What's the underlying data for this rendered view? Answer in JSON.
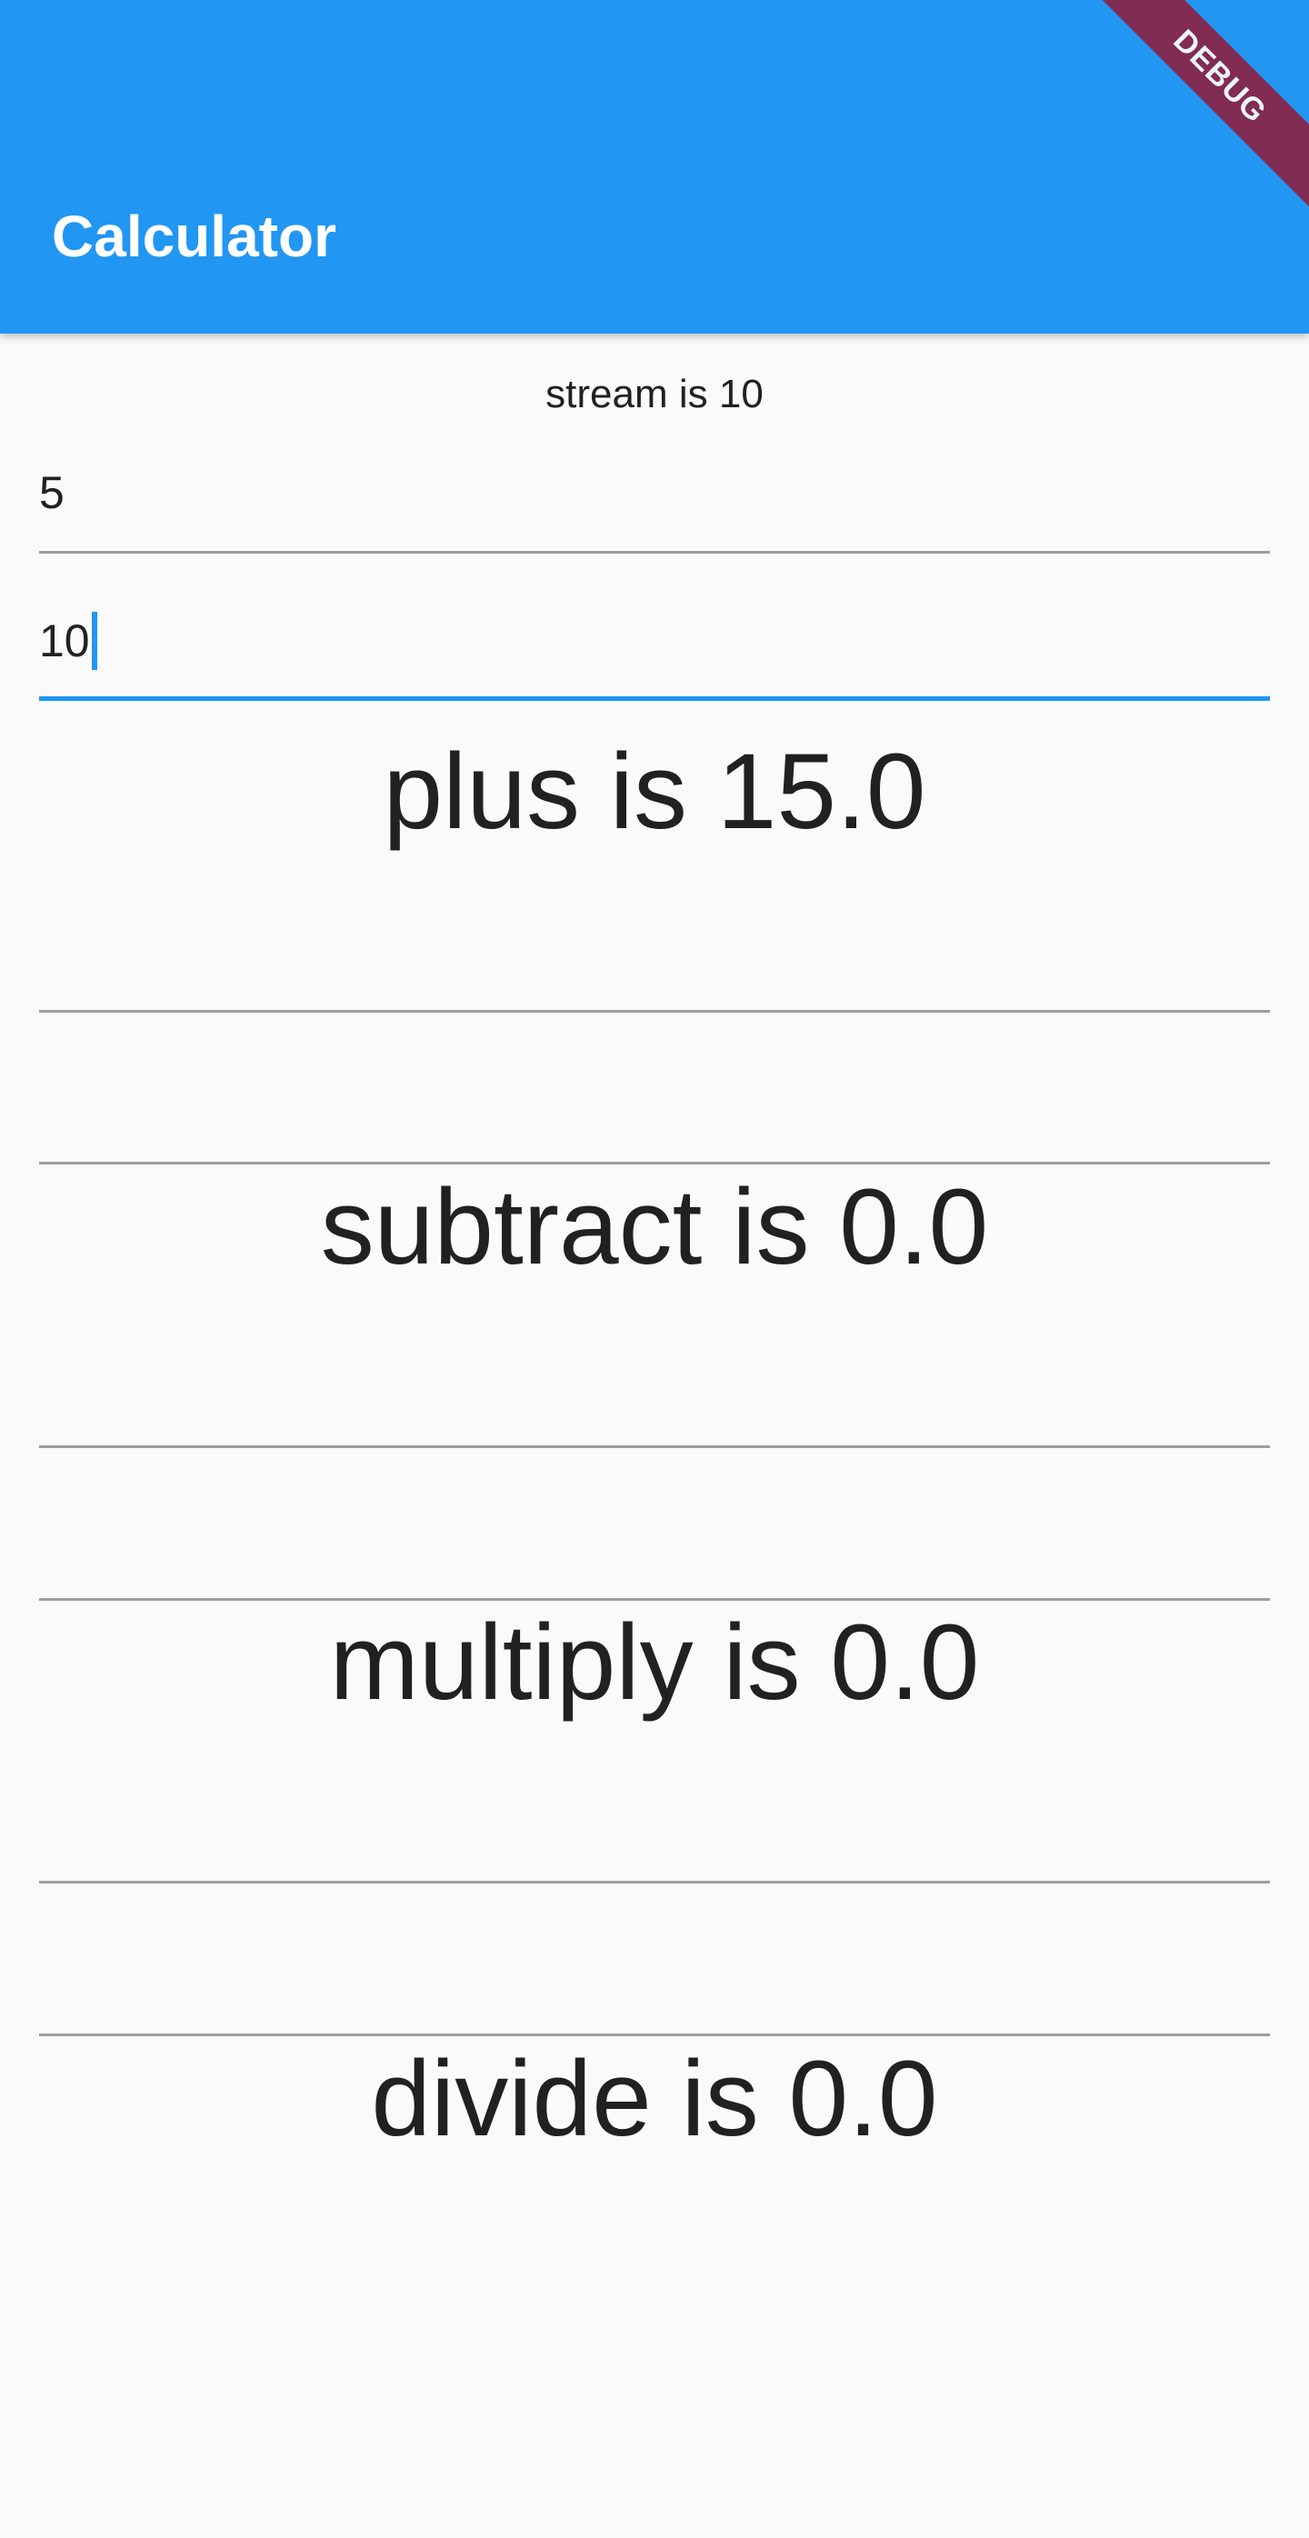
{
  "app_bar": {
    "title": "Calculator",
    "color": "#2196f3"
  },
  "debug_banner": {
    "label": "DEBUG"
  },
  "stream": {
    "text": "stream is 10"
  },
  "inputs": {
    "first_value": "5",
    "second_value": "10"
  },
  "results": {
    "plus": "plus is 15.0",
    "subtract": "subtract is 0.0",
    "multiply": "multiply is 0.0",
    "divide": "divide is 0.0"
  }
}
